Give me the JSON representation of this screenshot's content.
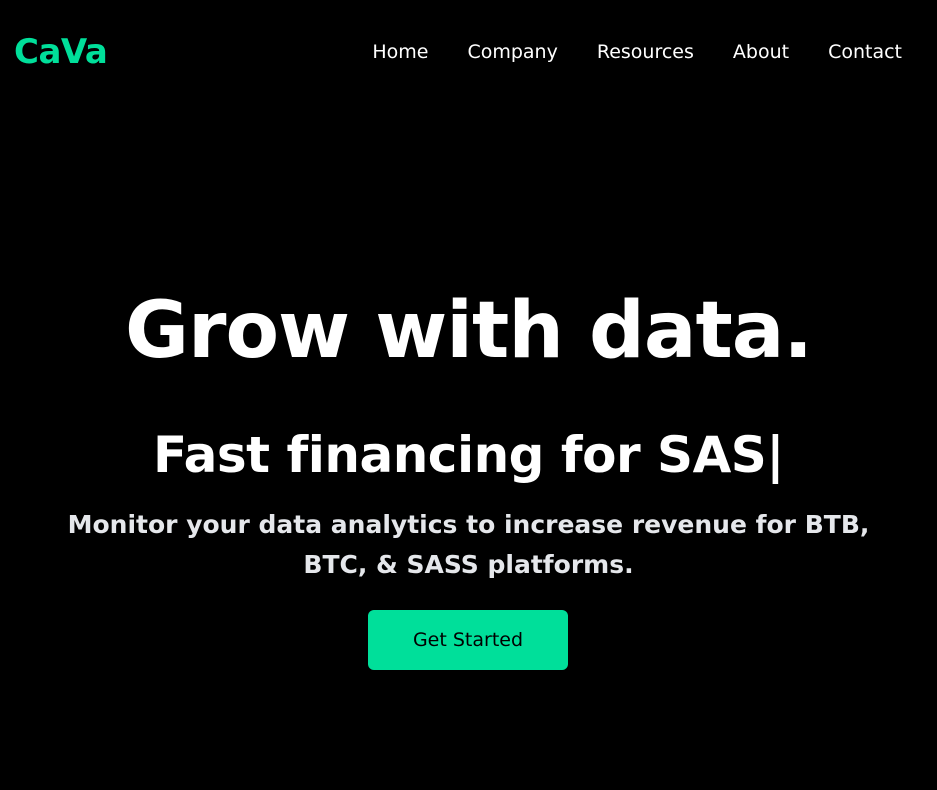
{
  "brand": {
    "logo_text": "CaVa",
    "accent_color": "#00df9a",
    "background_color": "#000000"
  },
  "nav": {
    "items": [
      {
        "label": "Home"
      },
      {
        "label": "Company"
      },
      {
        "label": "Resources"
      },
      {
        "label": "About"
      },
      {
        "label": "Contact"
      }
    ]
  },
  "hero": {
    "title": "Grow with data.",
    "subtitle": "Fast financing for SAS|",
    "description": "Monitor your data analytics to increase revenue for BTB, BTC, & SASS platforms.",
    "cta_label": "Get Started"
  }
}
